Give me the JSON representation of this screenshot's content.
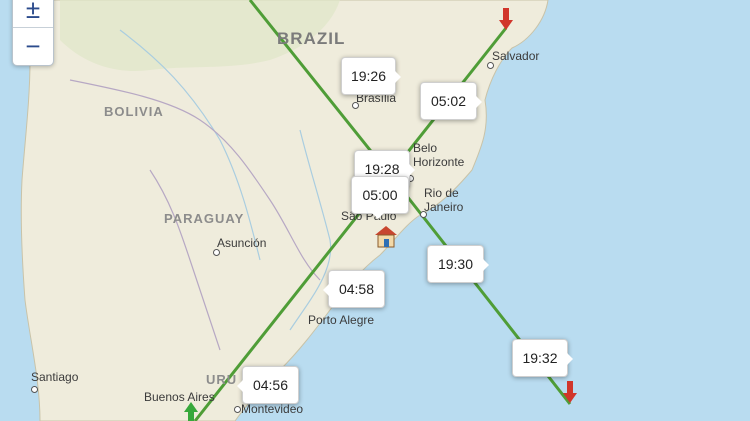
{
  "map": {
    "countries": [
      "BRAZIL",
      "BOLIVIA",
      "PARAGUAY",
      "URU"
    ],
    "cities": [
      "Salvador",
      "Brasília",
      "Belo Horizonte",
      "Rio de Janeiro",
      "São Paulo",
      "Asunción",
      "Porto Alegre",
      "Santiago",
      "Buenos Aires",
      "Montevideo"
    ],
    "colors": {
      "track": "#4f9d37",
      "water": "#b9dcf0",
      "land": "#efecdc",
      "arrow_red": "#d1362b",
      "arrow_green": "#37a83b"
    }
  },
  "zoom": {
    "in_label": "±",
    "out_label": "−"
  },
  "times": [
    "19:26",
    "05:02",
    "19:28",
    "05:00",
    "04:58",
    "19:30",
    "19:32",
    "04:56"
  ],
  "icons": [
    "arrow-down-icon",
    "arrow-down-icon",
    "arrow-up-icon",
    "house-icon"
  ]
}
